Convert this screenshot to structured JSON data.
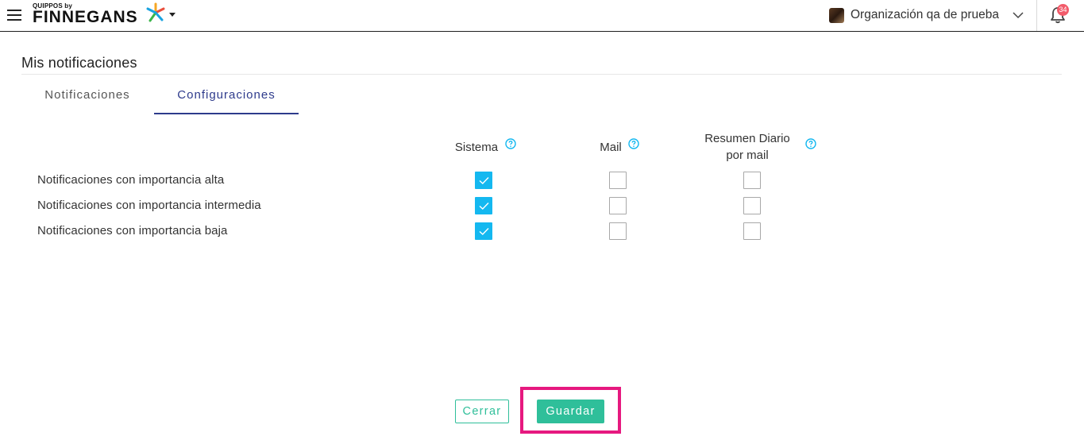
{
  "header": {
    "logo_small": "QUIPPOS by",
    "logo_big": "FINNEGANS",
    "organization": "Organización qa de prueba",
    "notification_count": "34"
  },
  "page": {
    "title": "Mis notificaciones",
    "tabs": [
      {
        "label": "Notificaciones",
        "active": false
      },
      {
        "label": "Configuraciones",
        "active": true
      }
    ]
  },
  "settings": {
    "columns": [
      {
        "label": "Sistema"
      },
      {
        "label": "Mail"
      },
      {
        "label": "Resumen Diario por mail"
      }
    ],
    "rows": [
      {
        "label": "Notificaciones con importancia alta",
        "values": [
          true,
          false,
          false
        ]
      },
      {
        "label": "Notificaciones con importancia intermedia",
        "values": [
          true,
          false,
          false
        ]
      },
      {
        "label": "Notificaciones con importancia baja",
        "values": [
          true,
          false,
          false
        ]
      }
    ]
  },
  "footer": {
    "close_label": "Cerrar",
    "save_label": "Guardar"
  },
  "colors": {
    "accent": "#2fbf9a",
    "checkbox_checked": "#14b8f0",
    "tab_active": "#2e3b8c",
    "highlight": "#e6197f",
    "badge": "#f25b6a"
  }
}
